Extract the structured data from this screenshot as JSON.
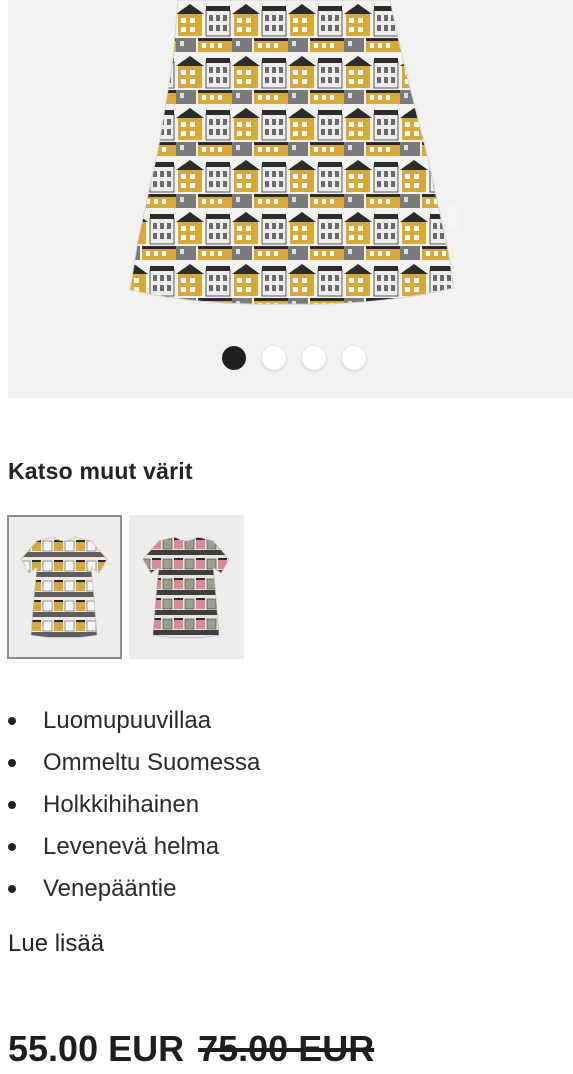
{
  "gallery": {
    "slide_count": 4,
    "active_index": 0
  },
  "colors": {
    "title": "Katso muut värit",
    "swatches": [
      {
        "name": "yellow-grey-houses",
        "selected": true
      },
      {
        "name": "pink-grey-houses",
        "selected": false
      }
    ]
  },
  "features": [
    "Luomupuuvillaa",
    "Ommeltu Suomessa",
    "Holkkihihainen",
    "Levenevä helma",
    "Venepääntie"
  ],
  "read_more": "Lue lisää",
  "price": {
    "current": "55.00 EUR",
    "original": "75.00 EUR"
  },
  "palette": {
    "hero_bg": "#f3f2f0",
    "mustard": "#d8a93a",
    "dark_grey": "#3a3a3a",
    "mid_grey": "#7a7a7a",
    "pink": "#d98a9a"
  }
}
